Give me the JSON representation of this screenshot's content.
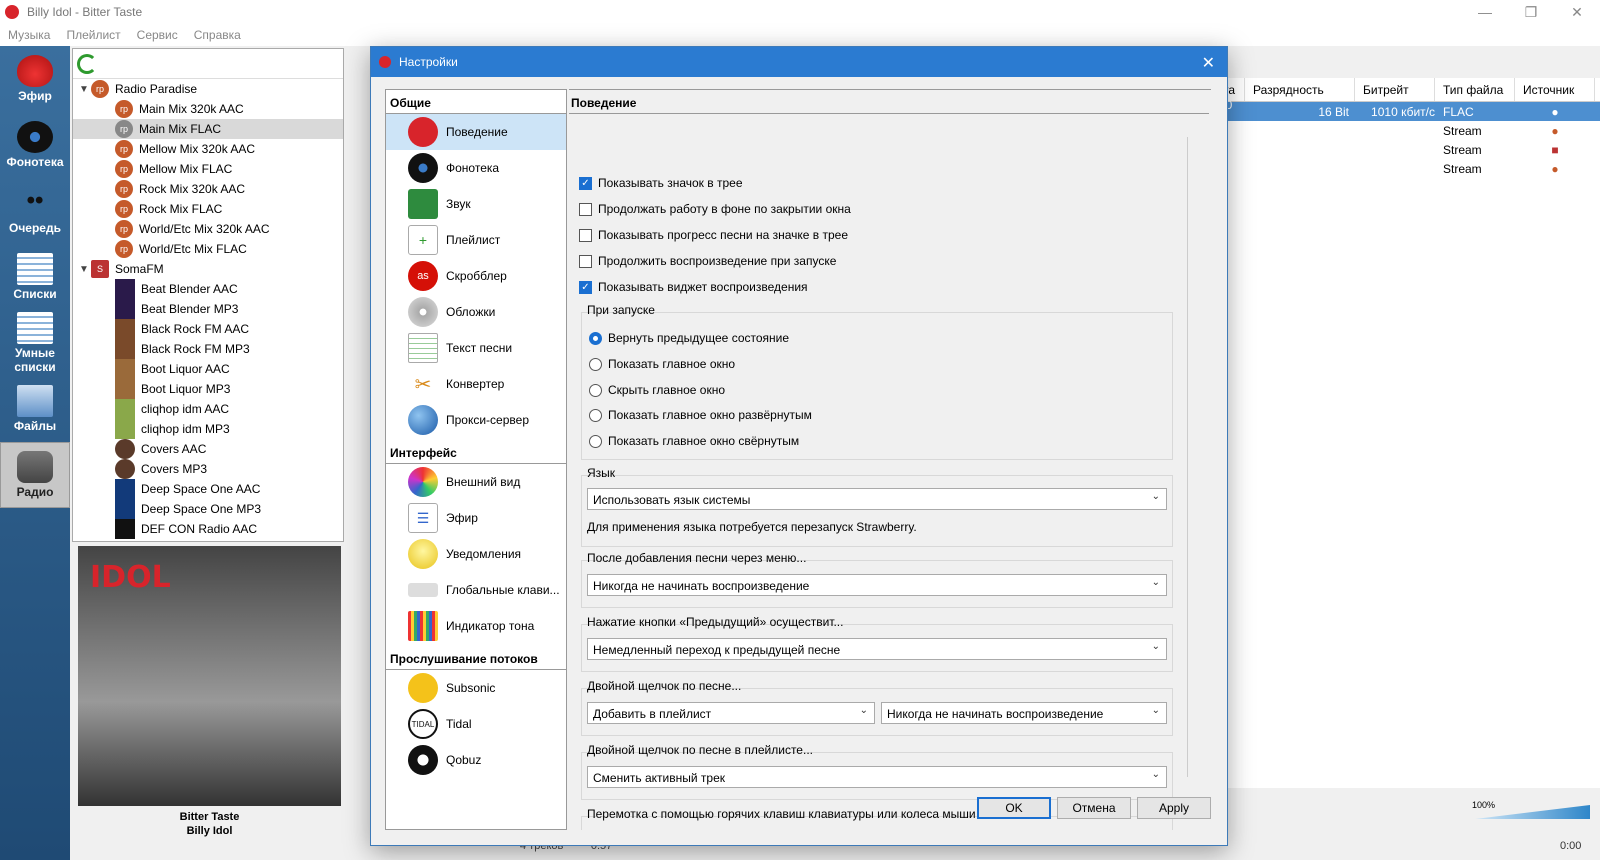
{
  "window": {
    "title": "Billy Idol - Bitter Taste",
    "buttons": [
      "—",
      "❐",
      "✕"
    ]
  },
  "menu": [
    "Музыка",
    "Плейлист",
    "Сервис",
    "Справка"
  ],
  "sidebar": [
    {
      "label": "Эфир",
      "icon": "strawberry-icon"
    },
    {
      "label": "Фонотека",
      "icon": "vinyl-icon"
    },
    {
      "label": "Очередь",
      "icon": "footsteps-icon"
    },
    {
      "label": "Списки",
      "icon": "playlist-icon"
    },
    {
      "label": "Умные списки",
      "icon": "smart-playlist-icon"
    },
    {
      "label": "Файлы",
      "icon": "files-icon"
    },
    {
      "label": "Радио",
      "icon": "radio-icon"
    }
  ],
  "tree": {
    "radio_paradise": {
      "label": "Radio Paradise",
      "items": [
        "Main Mix 320k AAC",
        "Main Mix FLAC",
        "Mellow Mix 320k AAC",
        "Mellow Mix FLAC",
        "Rock Mix 320k AAC",
        "Rock Mix FLAC",
        "World/Etc Mix 320k AAC",
        "World/Etc Mix FLAC"
      ]
    },
    "somafm": {
      "label": "SomaFM",
      "items": [
        "Beat Blender AAC",
        "Beat Blender MP3",
        "Black Rock FM AAC",
        "Black Rock FM MP3",
        "Boot Liquor AAC",
        "Boot Liquor MP3",
        "cliqhop idm AAC",
        "cliqhop idm MP3",
        "Covers AAC",
        "Covers MP3",
        "Deep Space One AAC",
        "Deep Space One MP3",
        "DEF CON Radio AAC"
      ]
    }
  },
  "album": {
    "title": "Bitter Taste",
    "artist": "Billy Idol",
    "art_text": "IDOL"
  },
  "playlist": {
    "columns": [
      "...та",
      "Разрядность",
      "Битрейт",
      "Тип файла",
      "Источник"
    ],
    "rows": [
      {
        "rate": "...00 Hz",
        "depth": "16 Bit",
        "bitrate": "1010 кбит/с",
        "type": "FLAC"
      },
      {
        "rate": "",
        "depth": "",
        "bitrate": "",
        "type": "Stream"
      },
      {
        "rate": "",
        "depth": "",
        "bitrate": "",
        "type": "Stream"
      },
      {
        "rate": "",
        "depth": "",
        "bitrate": "",
        "type": "Stream"
      }
    ]
  },
  "status": {
    "tracks": "4 треков",
    "elapsed": "0:57",
    "time_right": "0:00",
    "volume": "100%"
  },
  "dialog": {
    "title": "Настройки",
    "nav": {
      "general": {
        "label": "Общие",
        "items": [
          "Поведение",
          "Фонотека",
          "Звук",
          "Плейлист",
          "Скробблер",
          "Обложки",
          "Текст песни",
          "Конвертер",
          "Прокси-сервер"
        ]
      },
      "interface": {
        "label": "Интерфейс",
        "items": [
          "Внешний вид",
          "Эфир",
          "Уведомления",
          "Глобальные клави...",
          "Индикатор тона"
        ]
      },
      "streaming": {
        "label": "Прослушивание потоков",
        "items": [
          "Subsonic",
          "Tidal",
          "Qobuz"
        ]
      }
    },
    "page_title": "Поведение",
    "checkboxes": [
      {
        "label": "Показывать значок в трее",
        "checked": true
      },
      {
        "label": "Продолжать работу в фоне по закрытии окна",
        "checked": false
      },
      {
        "label": "Показывать прогресс песни на значке в трее",
        "checked": false
      },
      {
        "label": "Продолжить воспроизведение при запуске",
        "checked": false
      },
      {
        "label": "Показывать виджет воспроизведения",
        "checked": true
      }
    ],
    "startup": {
      "label": "При запуске",
      "options": [
        "Вернуть предыдущее состояние",
        "Показать главное окно",
        "Скрыть главное окно",
        "Показать главное окно развёрнутым",
        "Показать главное окно свёрнутым"
      ],
      "selected": "Вернуть предыдущее состояние"
    },
    "language": {
      "label": "Язык",
      "value": "Использовать язык системы",
      "note": "Для применения языка потребуется перезапуск Strawberry."
    },
    "after_add": {
      "label": "После добавления песни через меню...",
      "value": "Никогда не начинать воспроизведение"
    },
    "previous": {
      "label": "Нажатие кнопки «Предыдущий» осуществит...",
      "value": "Немедленный переход к предыдущей песне"
    },
    "double_click": {
      "label": "Двойной щелчок по песне...",
      "value1": "Добавить в плейлист",
      "value2": "Никогда не начинать воспроизведение"
    },
    "double_click_playlist": {
      "label": "Двойной щелчок по песне в плейлисте...",
      "value": "Сменить активный трек"
    },
    "seek": {
      "label": "Перемотка с помощью горячих клавиш клавиатуры или колеса мыши"
    },
    "buttons": {
      "ok": "OK",
      "cancel": "Отмена",
      "apply": "Apply"
    }
  },
  "colors": {
    "accent": "#1a6fd1",
    "title_bar": "#2b7bd1",
    "sidebar": "#2c5a86",
    "selection": "#4d8fd0"
  }
}
